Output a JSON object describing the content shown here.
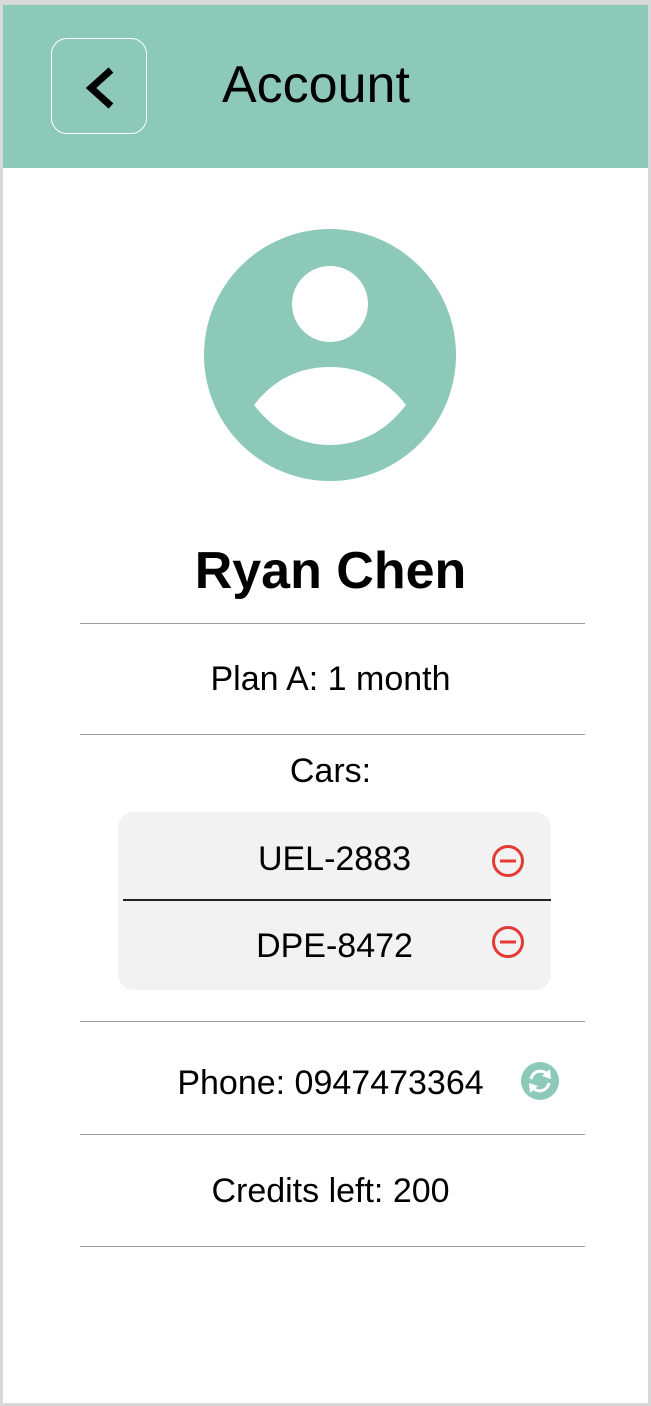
{
  "header": {
    "title": "Account",
    "background_color": "#8cc9b8",
    "back_icon": "chevron-left-icon"
  },
  "profile": {
    "avatar_icon": "user-avatar-icon",
    "avatar_color": "#8cc9b8",
    "name": "Ryan Chen"
  },
  "plan": {
    "text": "Plan A: 1 month"
  },
  "cars": {
    "label": "Cars:",
    "items": [
      {
        "plate": "UEL-2883",
        "action_icon": "remove-circle-icon"
      },
      {
        "plate": "DPE-8472",
        "action_icon": "remove-circle-icon"
      }
    ],
    "remove_color": "#e53935"
  },
  "phone": {
    "text": "Phone: 0947473364",
    "action_icon": "refresh-icon"
  },
  "credits": {
    "text": "Credits left: 200"
  }
}
